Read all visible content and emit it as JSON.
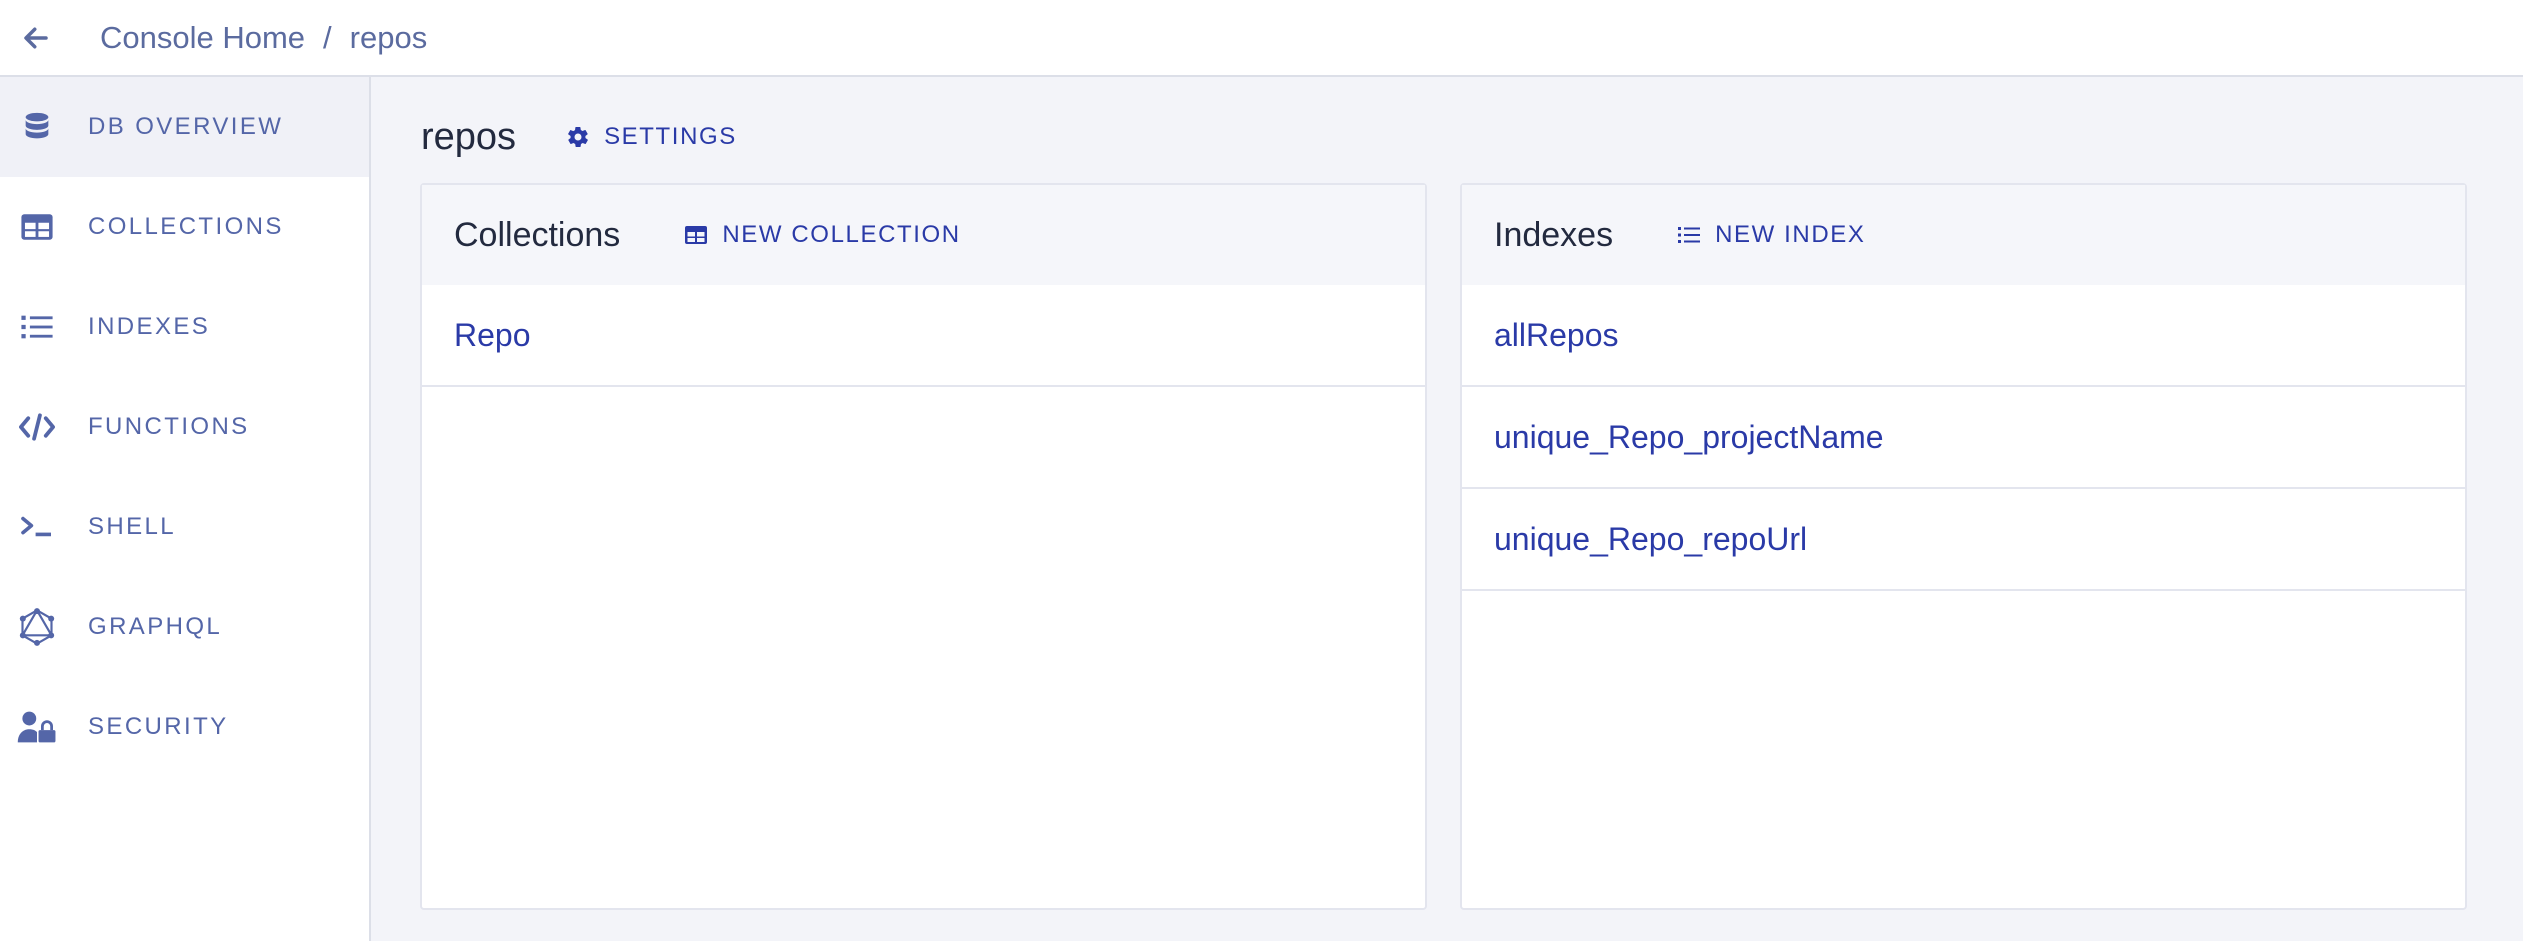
{
  "breadcrumb": {
    "home": "Console Home",
    "separator": "/",
    "current": "repos"
  },
  "sidebar": {
    "items": [
      {
        "label": "DB OVERVIEW",
        "icon": "database-icon",
        "active": true
      },
      {
        "label": "COLLECTIONS",
        "icon": "table-icon"
      },
      {
        "label": "INDEXES",
        "icon": "list-icon"
      },
      {
        "label": "FUNCTIONS",
        "icon": "code-icon"
      },
      {
        "label": "SHELL",
        "icon": "terminal-icon"
      },
      {
        "label": "GRAPHQL",
        "icon": "graphql-icon"
      },
      {
        "label": "SECURITY",
        "icon": "user-lock-icon"
      }
    ]
  },
  "main": {
    "title": "repos",
    "settings_label": "SETTINGS",
    "collections": {
      "title": "Collections",
      "action_label": "NEW COLLECTION",
      "rows": [
        "Repo"
      ]
    },
    "indexes": {
      "title": "Indexes",
      "action_label": "NEW INDEX",
      "rows": [
        "allRepos",
        "unique_Repo_projectName",
        "unique_Repo_repoUrl"
      ]
    }
  },
  "colors": {
    "accent": "#2a3aa7",
    "nav_text": "#5466a8",
    "background": "#f3f4f9"
  }
}
